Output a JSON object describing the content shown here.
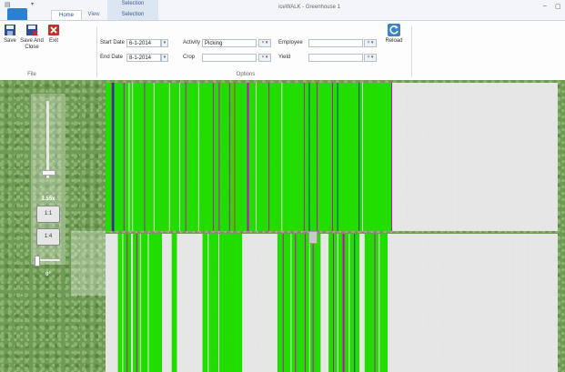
{
  "window": {
    "title": "iceWALK - Greenhouse 1",
    "context_tab_group": "Selection",
    "minimize_symbol": "–",
    "maximize_symbol": "▢"
  },
  "app_button": {
    "label": "",
    "color": "#2d7fd0"
  },
  "tabs": [
    {
      "label": "Home",
      "active": true
    },
    {
      "label": "View",
      "active": false
    },
    {
      "label": "Selection",
      "active": false
    }
  ],
  "ribbon": {
    "file_group": {
      "label": "File",
      "buttons": [
        {
          "label": "Save",
          "icon": "save-icon"
        },
        {
          "label": "Save And Close",
          "icon": "save-close-icon"
        },
        {
          "label": "Exit",
          "icon": "exit-icon"
        }
      ]
    },
    "options_group": {
      "label": "Options",
      "start_date": {
        "label": "Start Date",
        "value": "6-1-2014"
      },
      "end_date": {
        "label": "End Date",
        "value": "8-1-2014"
      },
      "activity": {
        "label": "Activity",
        "value": "Picking"
      },
      "crop": {
        "label": "Crop",
        "value": ""
      },
      "employee": {
        "label": "Employee",
        "value": ""
      },
      "yield": {
        "label": "Yield",
        "value": ""
      },
      "clear_symbol": "× ▾"
    },
    "reload_button": {
      "label": "Reload",
      "icon": "reload-icon"
    }
  },
  "navigator": {
    "zoom_level": "1.55x",
    "zoom_buttons": [
      "1:1",
      "1:4"
    ],
    "rotation": "0°",
    "zoom_slider_fraction": 0.88,
    "rotation_slider_fraction": 0.05
  },
  "colors": {
    "row_green": "#22dd00",
    "row_white": "#e6e6e6",
    "row_magenta": "#cc00cc",
    "row_blue": "#0a3a8a",
    "row_red": "#dd2222",
    "row_dark_green": "#0a8a0a",
    "grass": "#6e9a55"
  },
  "heatmap": {
    "top_rows": [
      "g",
      "g",
      "g",
      "g",
      "g",
      "g",
      "g",
      "m",
      "b",
      "b",
      "g",
      "g",
      "g",
      "g",
      "g",
      "g",
      "g",
      "g",
      "g",
      "g",
      "g",
      "m",
      "g",
      "g",
      "g",
      "g",
      "g",
      "w",
      "g",
      "g",
      "g",
      "w",
      "g",
      "g",
      "g",
      "g",
      "g",
      "g",
      "g",
      "g",
      "g",
      "g",
      "g",
      "g",
      "g",
      "m",
      "g",
      "g",
      "g",
      "g",
      "g",
      "g",
      "g",
      "g",
      "g",
      "g",
      "w",
      "g",
      "g",
      "g",
      "g",
      "g",
      "g",
      "g",
      "g",
      "g",
      "g",
      "g",
      "g",
      "g",
      "g",
      "g",
      "g",
      "g",
      "w",
      "g",
      "g",
      "g",
      "g",
      "g",
      "g",
      "g",
      "g",
      "g",
      "g",
      "g",
      "w",
      "g",
      "g",
      "g",
      "g",
      "g",
      "g",
      "m",
      "g",
      "g",
      "g",
      "g",
      "g",
      "g",
      "g",
      "g",
      "g",
      "g",
      "g",
      "g",
      "g",
      "g",
      "w",
      "g",
      "g",
      "g",
      "g",
      "g",
      "g",
      "g",
      "g",
      "g",
      "g",
      "g",
      "g",
      "g",
      "g",
      "g",
      "g",
      "m",
      "g",
      "g",
      "g",
      "g",
      "g",
      "g",
      "m",
      "g",
      "g",
      "g",
      "g",
      "g",
      "g",
      "g",
      "g",
      "g",
      "g",
      "g",
      "m",
      "g",
      "g",
      "g",
      "g",
      "g",
      "r",
      "g",
      "g",
      "g",
      "g",
      "g",
      "g",
      "g",
      "g",
      "g",
      "g",
      "g",
      "g",
      "g",
      "g",
      "m",
      "m",
      "g",
      "g",
      "g",
      "g",
      "g",
      "g",
      "g",
      "g",
      "w",
      "g",
      "g",
      "g",
      "g",
      "g",
      "g",
      "g",
      "g",
      "g",
      "g",
      "g",
      "g",
      "g",
      "g",
      "m",
      "g",
      "g",
      "g",
      "g",
      "g",
      "g",
      "g",
      "g",
      "g",
      "g",
      "g",
      "g",
      "g",
      "g",
      "w",
      "g",
      "g",
      "g",
      "g",
      "g",
      "g",
      "g",
      "g",
      "g",
      "g",
      "g",
      "g",
      "g",
      "g",
      "g",
      "g",
      "g",
      "g",
      "g",
      "g",
      "g",
      "g",
      "g",
      "g",
      "g",
      "m",
      "g",
      "g",
      "g",
      "g",
      "g",
      "b",
      "g",
      "g",
      "g",
      "g",
      "g",
      "g",
      "g",
      "g",
      "m",
      "g",
      "g",
      "g",
      "g",
      "g",
      "g",
      "g",
      "g",
      "g",
      "g",
      "g",
      "g",
      "g",
      "g",
      "g",
      "g",
      "g",
      "m",
      "g",
      "g",
      "g",
      "g",
      "g",
      "b",
      "g",
      "g",
      "g",
      "g",
      "g",
      "g",
      "g",
      "g",
      "g",
      "g",
      "g",
      "g",
      "g",
      "g",
      "g",
      "g",
      "g",
      "g",
      "g",
      "g",
      "g",
      "g",
      "g",
      "g",
      "b",
      "g",
      "g",
      "g",
      "w",
      "g",
      "g",
      "g",
      "g",
      "g",
      "g",
      "g",
      "g",
      "g",
      "g",
      "g",
      "g",
      "g",
      "g",
      "g",
      "g",
      "g",
      "g",
      "g",
      "g",
      "g",
      "g",
      "g",
      "g",
      "g",
      "g",
      "g",
      "g",
      "g",
      "g",
      "g",
      "g",
      "g",
      "m",
      "w",
      "w",
      "w",
      "w",
      "w",
      "w",
      "w",
      "w",
      "w",
      "w",
      "w",
      "w",
      "w",
      "w",
      "w",
      "w",
      "w",
      "w",
      "w",
      "w",
      "w",
      "w",
      "w",
      "w",
      "w",
      "w",
      "w",
      "w",
      "w",
      "w",
      "w",
      "w",
      "w",
      "w",
      "w",
      "w",
      "w",
      "w",
      "w",
      "w",
      "w",
      "w",
      "w",
      "w",
      "w",
      "w",
      "w",
      "w",
      "w",
      "w",
      "w",
      "w",
      "w",
      "w",
      "w",
      "w",
      "w",
      "w",
      "w",
      "w",
      "w",
      "w",
      "w",
      "w",
      "w",
      "w",
      "w",
      "w",
      "w",
      "w",
      "w",
      "w",
      "w",
      "w",
      "w",
      "w",
      "w",
      "w",
      "w",
      "w",
      "w",
      "w",
      "w",
      "w",
      "w",
      "w",
      "w",
      "w",
      "w",
      "w",
      "w",
      "w",
      "w",
      "w",
      "w",
      "w",
      "w",
      "w",
      "w",
      "w",
      "w",
      "w",
      "w",
      "w",
      "w",
      "w",
      "w",
      "w",
      "w",
      "w",
      "w",
      "w",
      "w",
      "w",
      "w",
      "w",
      "w",
      "w",
      "w",
      "w",
      "w",
      "w",
      "w",
      "w",
      "w",
      "w",
      "w",
      "w",
      "w",
      "w",
      "w",
      "w",
      "w",
      "w",
      "w",
      "w",
      "w",
      "w",
      "w",
      "w",
      "w",
      "w",
      "w",
      "w",
      "w",
      "w",
      "w",
      "w",
      "w",
      "w",
      "w",
      "w",
      "w",
      "w",
      "w",
      "w",
      "w",
      "w",
      "w",
      "w",
      "w",
      "w",
      "w",
      "w",
      "w",
      "w",
      "w",
      "w",
      "w",
      "w",
      "w",
      "w",
      "w",
      "w",
      "w",
      "w",
      "w",
      "w",
      "w",
      "w",
      "w",
      "w",
      "w",
      "w",
      "w",
      "w",
      "w",
      "w",
      "w",
      "w",
      "w",
      "w",
      "w"
    ],
    "bottom_rows": [
      "w",
      "w",
      "w",
      "w",
      "w",
      "w",
      "w",
      "w",
      "w",
      "w",
      "w",
      "w",
      "w",
      "w",
      "g",
      "g",
      "g",
      "g",
      "g",
      "w",
      "g",
      "g",
      "g",
      "g",
      "m",
      "g",
      "g",
      "g",
      "g",
      "w",
      "w",
      "g",
      "g",
      "g",
      "g",
      "m",
      "g",
      "g",
      "g",
      "w",
      "g",
      "g",
      "g",
      "g",
      "g",
      "g",
      "g",
      "g",
      "w",
      "g",
      "g",
      "g",
      "g",
      "g",
      "g",
      "g",
      "g",
      "g",
      "g",
      "g",
      "g",
      "g",
      "g",
      "g",
      "w",
      "w",
      "w",
      "w",
      "w",
      "w",
      "w",
      "w",
      "w",
      "w",
      "w",
      "g",
      "g",
      "g",
      "g",
      "g",
      "g",
      "w",
      "w",
      "w",
      "w",
      "w",
      "w",
      "w",
      "w",
      "w",
      "w",
      "w",
      "w",
      "w",
      "w",
      "w",
      "w",
      "w",
      "w",
      "w",
      "w",
      "w",
      "w",
      "w",
      "w",
      "w",
      "w",
      "w",
      "w",
      "w",
      "g",
      "g",
      "g",
      "g",
      "g",
      "g",
      "w",
      "g",
      "g",
      "g",
      "g",
      "g",
      "g",
      "g",
      "g",
      "g",
      "g",
      "g",
      "w",
      "g",
      "g",
      "g",
      "g",
      "g",
      "g",
      "g",
      "g",
      "g",
      "g",
      "g",
      "g",
      "g",
      "g",
      "g",
      "g",
      "g",
      "g",
      "g",
      "g",
      "g",
      "g",
      "g",
      "g",
      "g",
      "g",
      "w",
      "w",
      "w",
      "w",
      "w",
      "w",
      "w",
      "w",
      "w",
      "w",
      "w",
      "w",
      "w",
      "w",
      "w",
      "w",
      "w",
      "w",
      "w",
      "w",
      "w",
      "w",
      "w",
      "w",
      "w",
      "w",
      "w",
      "w",
      "w",
      "w",
      "w",
      "w",
      "w",
      "w",
      "w",
      "w",
      "w",
      "w",
      "w",
      "w",
      "g",
      "g",
      "g",
      "g",
      "g",
      "g",
      "m",
      "g",
      "g",
      "g",
      "g",
      "g",
      "g",
      "g",
      "g",
      "w",
      "g",
      "g",
      "g",
      "g",
      "m",
      "g",
      "g",
      "g",
      "g",
      "g",
      "g",
      "g",
      "g",
      "g",
      "g",
      "m",
      "g",
      "g",
      "g",
      "g",
      "w",
      "g",
      "g",
      "g",
      "m",
      "g",
      "g",
      "g",
      "g",
      "g",
      "g",
      "g",
      "g",
      "w",
      "w",
      "w",
      "w",
      "w",
      "w",
      "w",
      "w",
      "w",
      "g",
      "g",
      "g",
      "g",
      "g",
      "m",
      "g",
      "g",
      "g",
      "g",
      "w",
      "g",
      "g",
      "g",
      "g",
      "g",
      "m",
      "m",
      "g",
      "g",
      "g",
      "g",
      "g",
      "w",
      "g",
      "g",
      "g",
      "g",
      "g",
      "b",
      "g",
      "g",
      "g",
      "g",
      "g",
      "w",
      "w",
      "w",
      "w",
      "w",
      "w",
      "g",
      "g",
      "g",
      "g",
      "g",
      "g",
      "g",
      "g",
      "g",
      "g",
      "g",
      "m",
      "g",
      "g",
      "g",
      "g",
      "w",
      "g",
      "g",
      "g",
      "g",
      "g",
      "g",
      "g",
      "g",
      "g",
      "w",
      "w",
      "w",
      "w",
      "w",
      "w",
      "w",
      "w",
      "w",
      "w",
      "w",
      "w",
      "w",
      "w",
      "w",
      "w",
      "w",
      "w",
      "w",
      "w",
      "w",
      "w",
      "w",
      "w",
      "w",
      "w",
      "w",
      "w",
      "w",
      "w",
      "w",
      "w",
      "w",
      "w",
      "w",
      "w",
      "w",
      "w",
      "w",
      "w",
      "w",
      "w",
      "w",
      "w",
      "w",
      "w",
      "w",
      "w",
      "w",
      "w",
      "w",
      "w",
      "w",
      "w",
      "w",
      "w",
      "w",
      "w",
      "w",
      "w",
      "w",
      "w",
      "w",
      "w",
      "w",
      "w",
      "w",
      "w",
      "w",
      "w",
      "w",
      "w",
      "w",
      "w",
      "w",
      "w",
      "w",
      "w",
      "w",
      "w",
      "w",
      "w",
      "w",
      "w",
      "w",
      "w",
      "w",
      "w",
      "w",
      "w",
      "w",
      "w",
      "w",
      "w",
      "w",
      "w",
      "w",
      "w",
      "w",
      "w",
      "w",
      "w",
      "w",
      "w",
      "w",
      "w",
      "w",
      "w",
      "w",
      "w",
      "w",
      "w",
      "w",
      "w",
      "w",
      "w",
      "w",
      "w",
      "w",
      "w",
      "w",
      "w",
      "w",
      "w",
      "w",
      "w",
      "w",
      "w",
      "w",
      "w",
      "w",
      "w",
      "w",
      "w",
      "w",
      "w",
      "w",
      "w",
      "w",
      "w",
      "w",
      "w",
      "w",
      "w",
      "w",
      "w",
      "w",
      "w",
      "w",
      "w",
      "w",
      "w",
      "w",
      "w",
      "w",
      "w",
      "w",
      "w",
      "w",
      "w",
      "w",
      "w",
      "w",
      "w",
      "w",
      "w",
      "w",
      "w",
      "w",
      "w",
      "w",
      "w",
      "w",
      "w",
      "w",
      "w",
      "w",
      "w",
      "w",
      "w",
      "w",
      "w",
      "w",
      "w",
      "w",
      "w",
      "w",
      "w",
      "w",
      "w",
      "w",
      "w",
      "w"
    ]
  }
}
